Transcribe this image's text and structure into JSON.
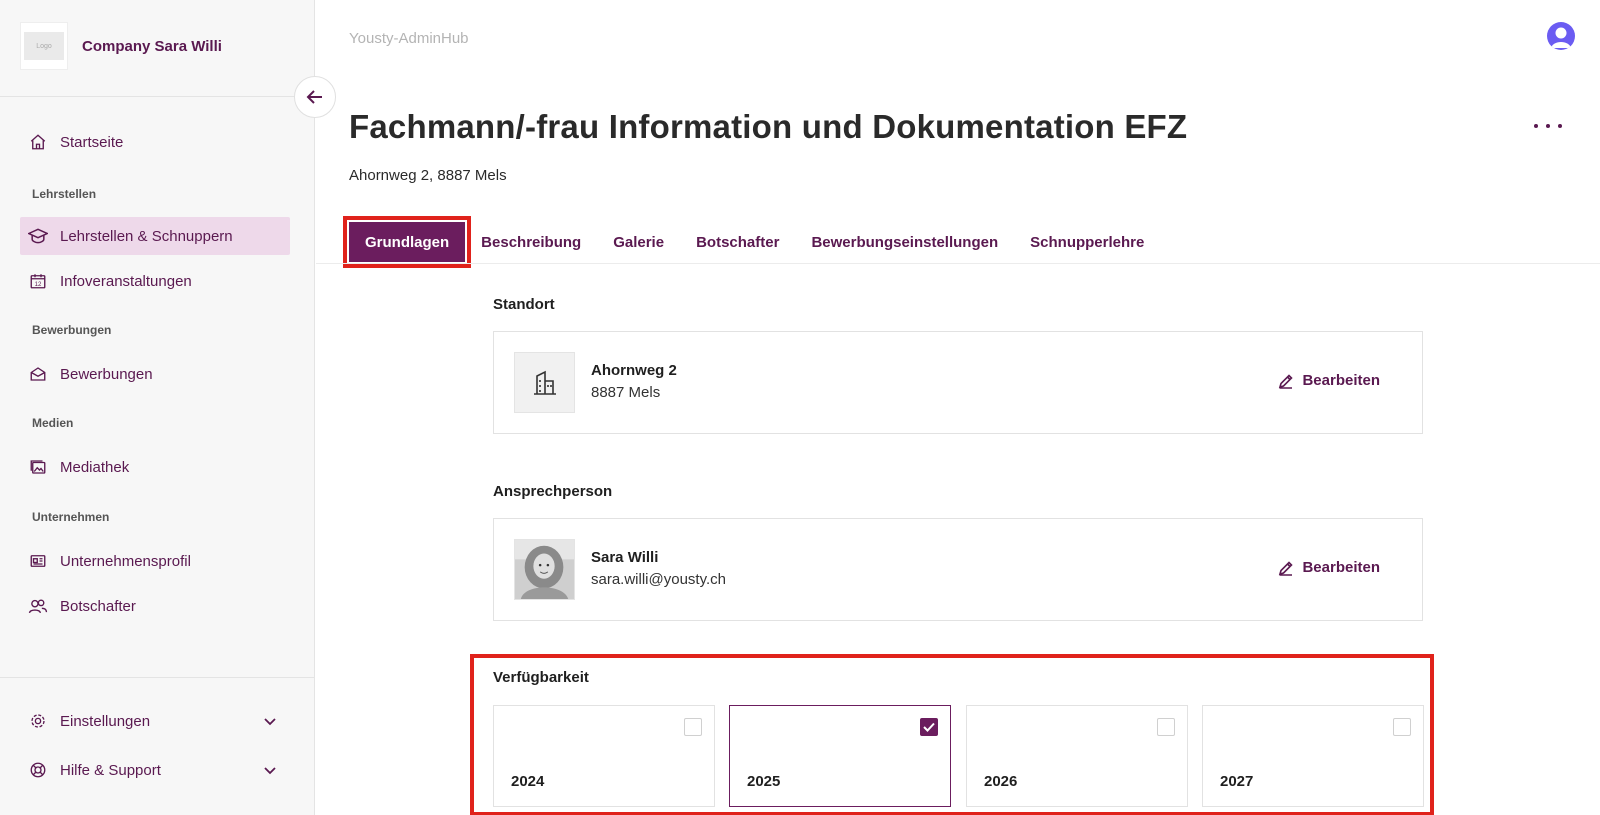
{
  "app": {
    "title": "Yousty-AdminHub"
  },
  "sidebar": {
    "company_name": "Company Sara Willi",
    "logo_text": "Logo",
    "items": [
      {
        "label": "Startseite",
        "icon": "home-icon"
      },
      {
        "section": "Lehrstellen"
      },
      {
        "label": "Lehrstellen & Schnuppern",
        "icon": "graduation-cap-icon",
        "active": true
      },
      {
        "label": "Infoveranstaltungen",
        "icon": "calendar-icon"
      },
      {
        "section": "Bewerbungen"
      },
      {
        "label": "Bewerbungen",
        "icon": "envelope-icon"
      },
      {
        "section": "Medien"
      },
      {
        "label": "Mediathek",
        "icon": "images-icon"
      },
      {
        "section": "Unternehmen"
      },
      {
        "label": "Unternehmensprofil",
        "icon": "profile-card-icon"
      },
      {
        "label": "Botschafter",
        "icon": "users-icon"
      },
      {
        "label": "Einstellungen",
        "icon": "gear-icon"
      },
      {
        "label": "Hilfe & Support",
        "icon": "lifebuoy-icon"
      }
    ],
    "calendar_icon_number": "12"
  },
  "header": {
    "title": "Fachmann/-frau Information und Dokumentation EFZ",
    "subtitle": "Ahornweg 2, 8887 Mels"
  },
  "tabs": [
    {
      "label": "Grundlagen",
      "active": true
    },
    {
      "label": "Beschreibung"
    },
    {
      "label": "Galerie"
    },
    {
      "label": "Botschafter"
    },
    {
      "label": "Bewerbungseinstellungen"
    },
    {
      "label": "Schnupperlehre"
    }
  ],
  "standort": {
    "label": "Standort",
    "street": "Ahornweg 2",
    "city": "8887 Mels",
    "edit_label": "Bearbeiten"
  },
  "contact": {
    "label": "Ansprechperson",
    "name": "Sara Willi",
    "email": "sara.willi@yousty.ch",
    "edit_label": "Bearbeiten"
  },
  "availability": {
    "label": "Verfügbarkeit",
    "years": [
      {
        "year": "2024",
        "checked": false
      },
      {
        "year": "2025",
        "checked": true
      },
      {
        "year": "2026",
        "checked": false
      },
      {
        "year": "2027",
        "checked": false
      }
    ]
  },
  "colors": {
    "brand": "#6b1d5e",
    "brand_text": "#5a1950",
    "active_nav_bg": "#eed9ea",
    "highlight": "#e0221b",
    "avatar": "#6b5cf2"
  }
}
